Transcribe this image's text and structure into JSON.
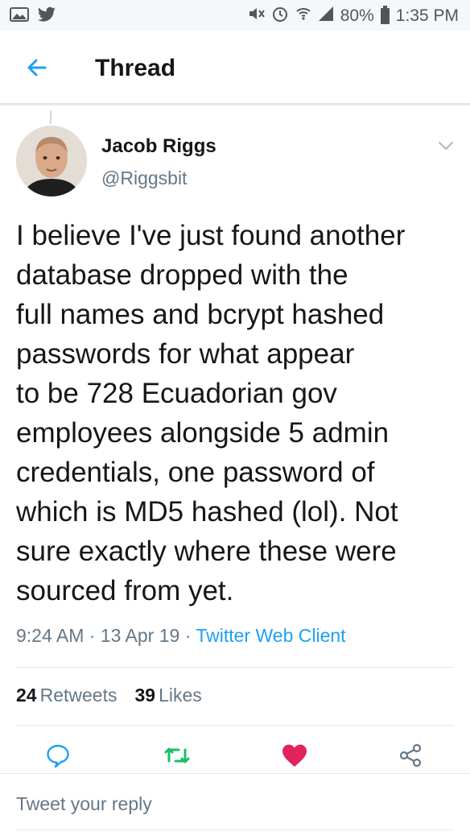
{
  "status_bar": {
    "battery": "80%",
    "time": "1:35 PM"
  },
  "app_bar": {
    "title": "Thread"
  },
  "tweet": {
    "author_name": "Jacob Riggs",
    "author_handle": "@Riggsbit",
    "text": "I believe I've just found another\ndatabase dropped with the\nfull names and bcrypt hashed\npasswords for what appear\nto be 728 Ecuadorian gov\nemployees alongside 5 admin\ncredentials, one password of\nwhich is MD5 hashed (lol). Not\nsure exactly where these were\nsourced from yet.",
    "time": "9:24 AM",
    "date": "13 Apr 19",
    "client": "Twitter Web Client",
    "separator": "·",
    "retweets_count": "24",
    "retweets_label": "Retweets",
    "likes_count": "39",
    "likes_label": "Likes"
  },
  "reply": {
    "placeholder": "Tweet your reply"
  },
  "icons": {
    "back": "arrow-left-icon",
    "caret": "chevron-down-icon",
    "reply": "comment-icon",
    "retweet": "retweet-icon",
    "like": "heart-icon",
    "share": "share-icon"
  },
  "colors": {
    "accent": "#1da1f2",
    "retweet": "#17bf63",
    "like": "#e0245e",
    "muted": "#657786"
  }
}
